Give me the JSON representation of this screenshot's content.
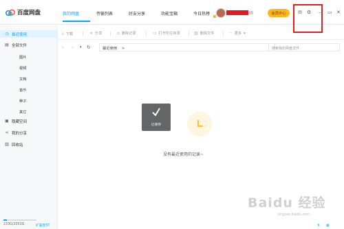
{
  "app": {
    "name": "百度网盘",
    "nav_tabs": [
      "我的网盘",
      "传输列表",
      "好友分享",
      "功能宝箱",
      "今日热榜"
    ],
    "avatar_badge": "V",
    "vip_label": "会员中心"
  },
  "toolbar": {
    "download": "下载",
    "share": "分享",
    "delete_record": "删除记录",
    "open_folder": "打开所在目录",
    "delete_file": "删除文件",
    "more": "更多"
  },
  "addressbar": {
    "breadcrumb": "最近使用",
    "crumb_arrow": ">",
    "search_placeholder": "搜索我的网盘文件"
  },
  "sidebar": {
    "items": [
      {
        "label": "最近使用",
        "icon": "clock-icon"
      },
      {
        "label": "全部文件",
        "icon": "file-icon"
      },
      {
        "label": "隐藏空间",
        "icon": "lock-icon"
      },
      {
        "label": "我的分享",
        "icon": "share-icon"
      },
      {
        "label": "回收站",
        "icon": "trash-icon"
      }
    ],
    "sub_items": [
      "图片",
      "视频",
      "文档",
      "音乐",
      "种子",
      "其它"
    ],
    "quota_text": "233G/2053G",
    "quota_link": "扩容至5T",
    "quota_used_fraction": 0.11
  },
  "main": {
    "saved_label": "已保存",
    "empty_text": "没有最近使用的记录~"
  },
  "watermark": {
    "text": "Baidu 经验",
    "sub": "jingyan.baidu.com"
  },
  "colors": {
    "accent": "#06a7ff",
    "vip": "#ffb61d",
    "highlight": "#e02020"
  }
}
